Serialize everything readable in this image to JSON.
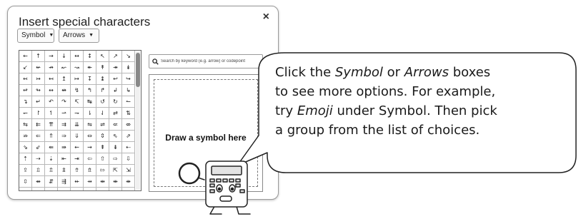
{
  "dialog": {
    "title": "Insert special characters",
    "close_label": "×",
    "symbol_dropdown": "Symbol",
    "arrows_dropdown": "Arrows",
    "search_placeholder": "Search by keyword (e.g. arrow) or codepoint",
    "draw_label": "Draw a symbol here"
  },
  "grid": {
    "rows": [
      [
        "←",
        "↑",
        "→",
        "↓",
        "↔",
        "↕",
        "↖",
        "↗",
        "↘",
        "↙"
      ],
      [
        "↚",
        "↛",
        "↜",
        "↝",
        "↞",
        "↟",
        "↠",
        "↡",
        "↢",
        "↣"
      ],
      [
        "↤",
        "↥",
        "↦",
        "↧",
        "↨",
        "↩",
        "↪",
        "↫",
        "↬",
        "↭"
      ],
      [
        "↮",
        "↯",
        "↰",
        "↱",
        "↲",
        "↳",
        "↴",
        "↵",
        "↶",
        "↷"
      ],
      [
        "↸",
        "↹",
        "↺",
        "↻",
        "↼",
        "↽",
        "↾",
        "↿",
        "⇀",
        "⇁"
      ],
      [
        "⇂",
        "⇃",
        "⇄",
        "⇅",
        "⇆",
        "⇇",
        "⇈",
        "⇉",
        "⇊",
        "⇋"
      ],
      [
        "⇌",
        "⇍",
        "⇎",
        "⇏",
        "⇐",
        "⇑",
        "⇒",
        "⇓",
        "⇔",
        "⇕"
      ],
      [
        "⇖",
        "⇗",
        "⇘",
        "⇙",
        "⇚",
        "⇛",
        "⇜",
        "⇝",
        "⇞",
        "⇟"
      ],
      [
        "⇠",
        "⇡",
        "⇢",
        "⇣",
        "⇤",
        "⇥",
        "⇦",
        "⇧",
        "⇨",
        "⇩"
      ],
      [
        "⇪",
        "⇫",
        "⇬",
        "⇭",
        "⇮",
        "⇯",
        "⇰",
        "⇱",
        "⇲",
        "⇳"
      ],
      [
        "⇴",
        "⇵",
        "⇶",
        "⇷",
        "⇸",
        "⇹",
        "⇺",
        "⇻",
        "⇼",
        "⇽"
      ],
      [
        "⇾",
        "⇿",
        "⟰",
        "⟱",
        "⟲",
        "⟳",
        "⟴",
        "⟵",
        "⟶",
        "⟷"
      ]
    ]
  },
  "bubble": {
    "line1_pre": "Click the ",
    "line1_em1": "Symbol",
    "line1_mid": " or ",
    "line1_em2": "Arrows",
    "line1_post": " boxes",
    "line2": "to see more options. For example,",
    "line3_pre": "try ",
    "line3_em": "Emoji",
    "line3_post": " under Symbol. Then pick",
    "line4": "a group from the list of choices."
  },
  "icons": {
    "search": "search-icon",
    "close": "close-icon",
    "caret": "caret-down-icon",
    "mascot": "calculator-mascot-icon"
  },
  "colors": {
    "border": "#9a9a9a",
    "text": "#222222",
    "bubble_stroke": "#222222"
  }
}
